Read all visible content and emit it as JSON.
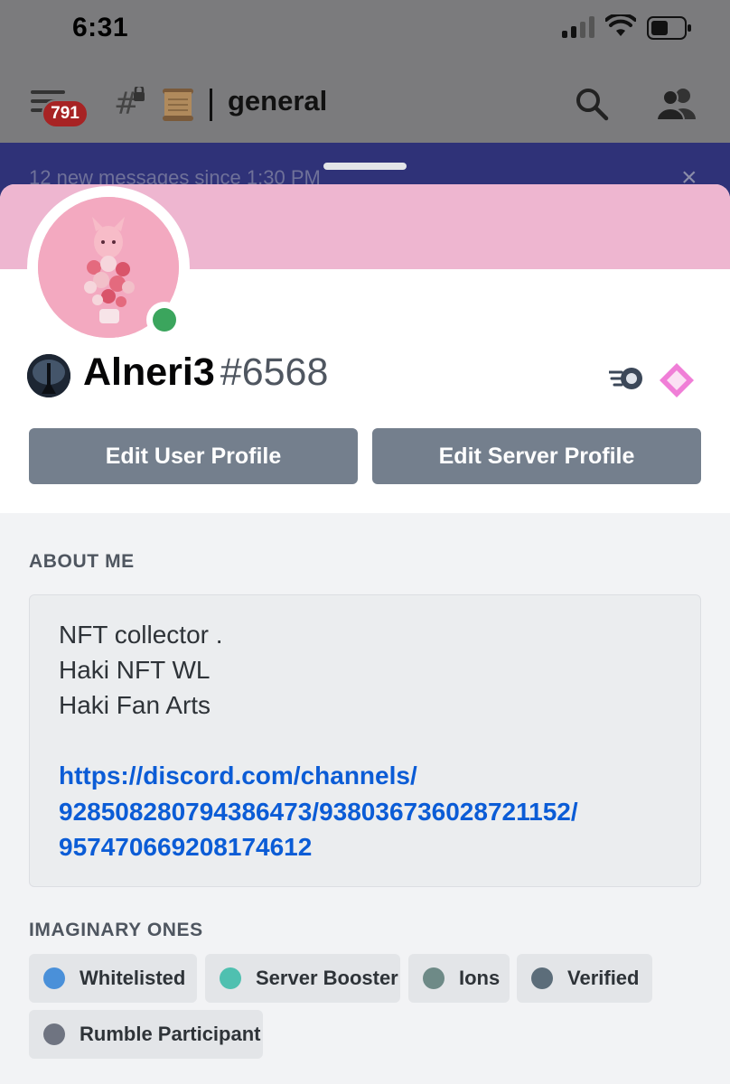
{
  "status_bar": {
    "time": "6:31"
  },
  "channel_header": {
    "unread_badge": "791",
    "channel_name": "general",
    "icons": [
      "menu-icon",
      "locked-hash-icon",
      "scroll-emoji",
      "search-icon",
      "members-icon"
    ]
  },
  "new_messages_bar": {
    "text": "12 new messages since 1:30 PM",
    "close_glyph": "×"
  },
  "profile": {
    "username": "Alneri3",
    "discriminator": "#6568",
    "banner_color": "#eeb6d0",
    "status_color": "#3ba55d",
    "badges": [
      "nitro-icon",
      "server-boost-icon"
    ],
    "buttons": {
      "edit_user": "Edit User Profile",
      "edit_server": "Edit Server Profile"
    }
  },
  "about_me": {
    "title": "ABOUT ME",
    "lines": [
      "NFT collector .",
      "Haki NFT WL",
      "Haki Fan Arts"
    ],
    "link_lines": [
      "https://discord.com/channels/",
      "928508280794386473/938036736028721152/",
      "957470669208174612"
    ]
  },
  "roles": {
    "title": "IMAGINARY ONES",
    "items": [
      {
        "label": "Whitelisted",
        "color": "#4a90d9"
      },
      {
        "label": "Server Booster",
        "color": "#4fc0b0"
      },
      {
        "label": "Ions",
        "color": "#6e8a87"
      },
      {
        "label": "Verified",
        "color": "#5c6d7a"
      },
      {
        "label": "Rumble Participant",
        "color": "#6f7481"
      }
    ]
  }
}
